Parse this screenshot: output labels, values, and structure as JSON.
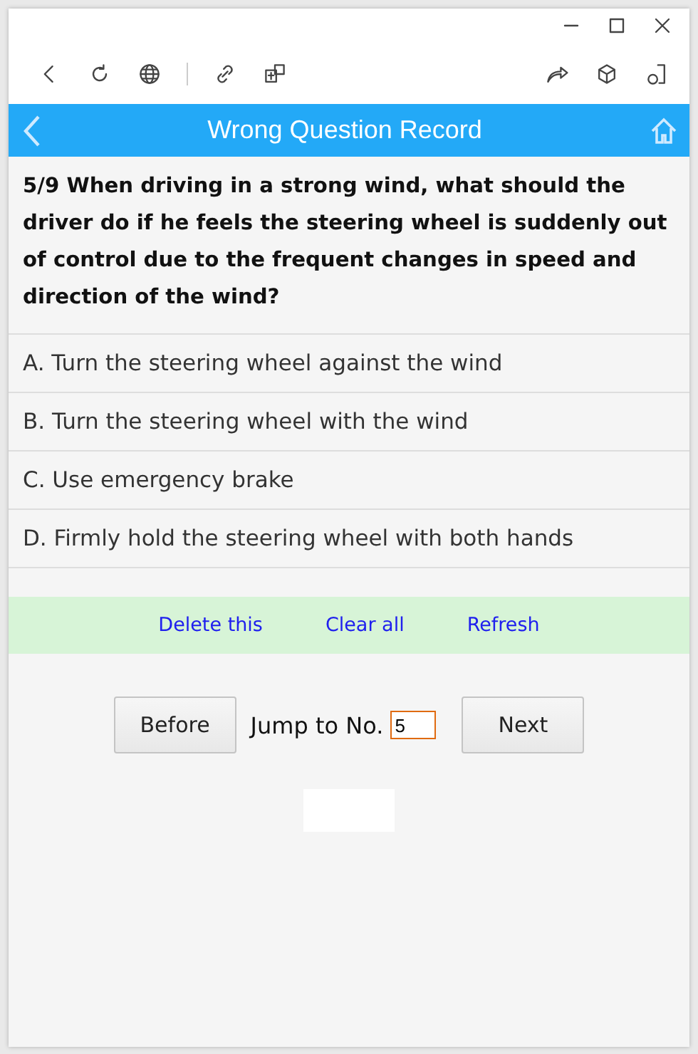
{
  "header": {
    "title": "Wrong Question Record"
  },
  "question": {
    "text": "5/9 When driving in a strong wind, what should the driver do if he feels the steering wheel is suddenly out of control due to the frequent changes in speed and direction of the wind?"
  },
  "options": [
    {
      "label": "A. Turn the steering wheel against the wind"
    },
    {
      "label": "B. Turn the steering wheel with the wind"
    },
    {
      "label": "C. Use emergency brake"
    },
    {
      "label": "D. Firmly hold the steering wheel with both hands"
    }
  ],
  "actions": [
    "Delete this",
    "Clear all",
    "Refresh"
  ],
  "navigation": {
    "previous": "Before",
    "jump_label": "Jump to No.",
    "jump_value": "5",
    "next": "Next"
  }
}
